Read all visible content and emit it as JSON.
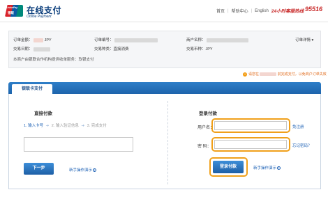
{
  "header": {
    "logo_text_en": "UnionPay",
    "logo_text_cn": "银联",
    "brand_cn": "在线支付",
    "brand_en": "Online Payment",
    "nav": [
      "首页",
      "帮助中心",
      "English"
    ],
    "hotline_label": "24小时客服热线",
    "hotline_number": "95516"
  },
  "order": {
    "amount_label": "订单金额：",
    "amount_currency": "JPY",
    "order_no_label": "订单编号：",
    "merchant_label": "商户名称：",
    "order_detail_link": "订单详情",
    "date_label": "交易日期：",
    "type_label": "交易种类：",
    "type_value": "直接消费",
    "currency_label": "交易币种：",
    "currency_value": "JPY",
    "notice": "本商户由银联合作机构提供收单服务：软银支付"
  },
  "warning": {
    "prefix": "请您在",
    "suffix": "前完成支付，以免商户订单失效"
  },
  "tabs": {
    "active_label": "银联卡支付"
  },
  "direct": {
    "title": "直接付款",
    "steps": [
      "1. 输入卡号",
      "2. 输入验证信息",
      "3. 完成支付"
    ],
    "next_button": "下一步",
    "demo_link": "新手操作演示"
  },
  "login": {
    "title": "登录付款",
    "username_label": "用户名：",
    "register_link": "免注册",
    "password_label": "密  码：",
    "forgot_link": "忘记密码？",
    "login_button": "登录付款",
    "demo_link": "新手操作演示"
  },
  "colors": {
    "accent_blue": "#1e64ac",
    "highlight_orange": "#f0a01a",
    "warning_orange": "#e06a1a",
    "hotline_red": "#c92b2b"
  }
}
